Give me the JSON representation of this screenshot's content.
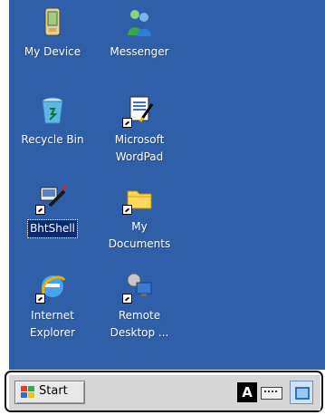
{
  "desktop": {
    "icons": [
      {
        "id": "my-device",
        "label": "My Device",
        "icon": "pda-icon"
      },
      {
        "id": "messenger",
        "label": "Messenger",
        "icon": "messenger-icon"
      },
      {
        "id": "recycle-bin",
        "label": "Recycle Bin",
        "icon": "recycle-bin-icon"
      },
      {
        "id": "wordpad",
        "label": "Microsoft\nWordPad",
        "icon": "wordpad-icon"
      },
      {
        "id": "bhtshell",
        "label": "BhtShell",
        "icon": "bhtshell-icon"
      },
      {
        "id": "my-documents",
        "label": "My\nDocuments",
        "icon": "folder-icon"
      },
      {
        "id": "internet-explorer",
        "label": "Internet\nExplorer",
        "icon": "internet-explorer-icon"
      },
      {
        "id": "remote-desktop",
        "label": "Remote\nDesktop ...",
        "icon": "remote-desktop-icon"
      }
    ],
    "background_color": "#2f5fa8"
  },
  "taskbar": {
    "start_label": "Start",
    "ime_label": "A",
    "tray_icons": [
      "keyboard-icon",
      "show-desktop-icon"
    ]
  }
}
